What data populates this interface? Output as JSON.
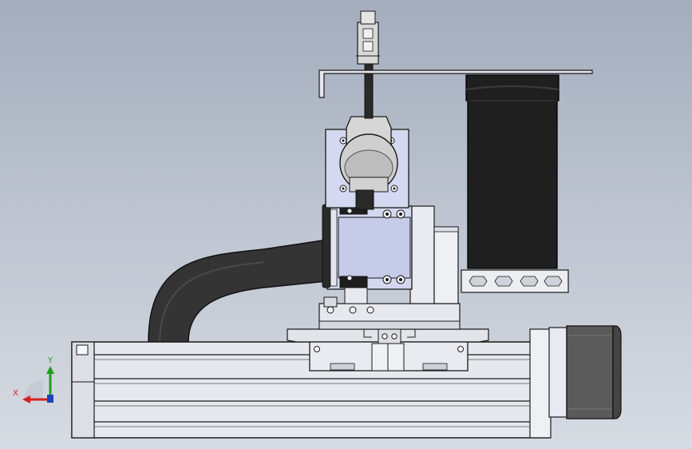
{
  "view": {
    "background_top": "#a3adbd",
    "background_bottom": "#d7dbe2"
  },
  "triad": {
    "x_label": "X",
    "y_label": "Y",
    "x_color": "#d42020",
    "y_color": "#1fa01f",
    "z_color": "#2040c0"
  },
  "palette": {
    "outline": "#1a1a1a",
    "aluminum": "#e4e6ec",
    "aluminum_shade": "#c9ccd6",
    "plate_blue": "#d4d8f0",
    "plate_blue_dark": "#b7bce0",
    "cable": "#2f2f2f",
    "motor_body": "#555555",
    "belt_wheel": "#1c1c1c"
  }
}
